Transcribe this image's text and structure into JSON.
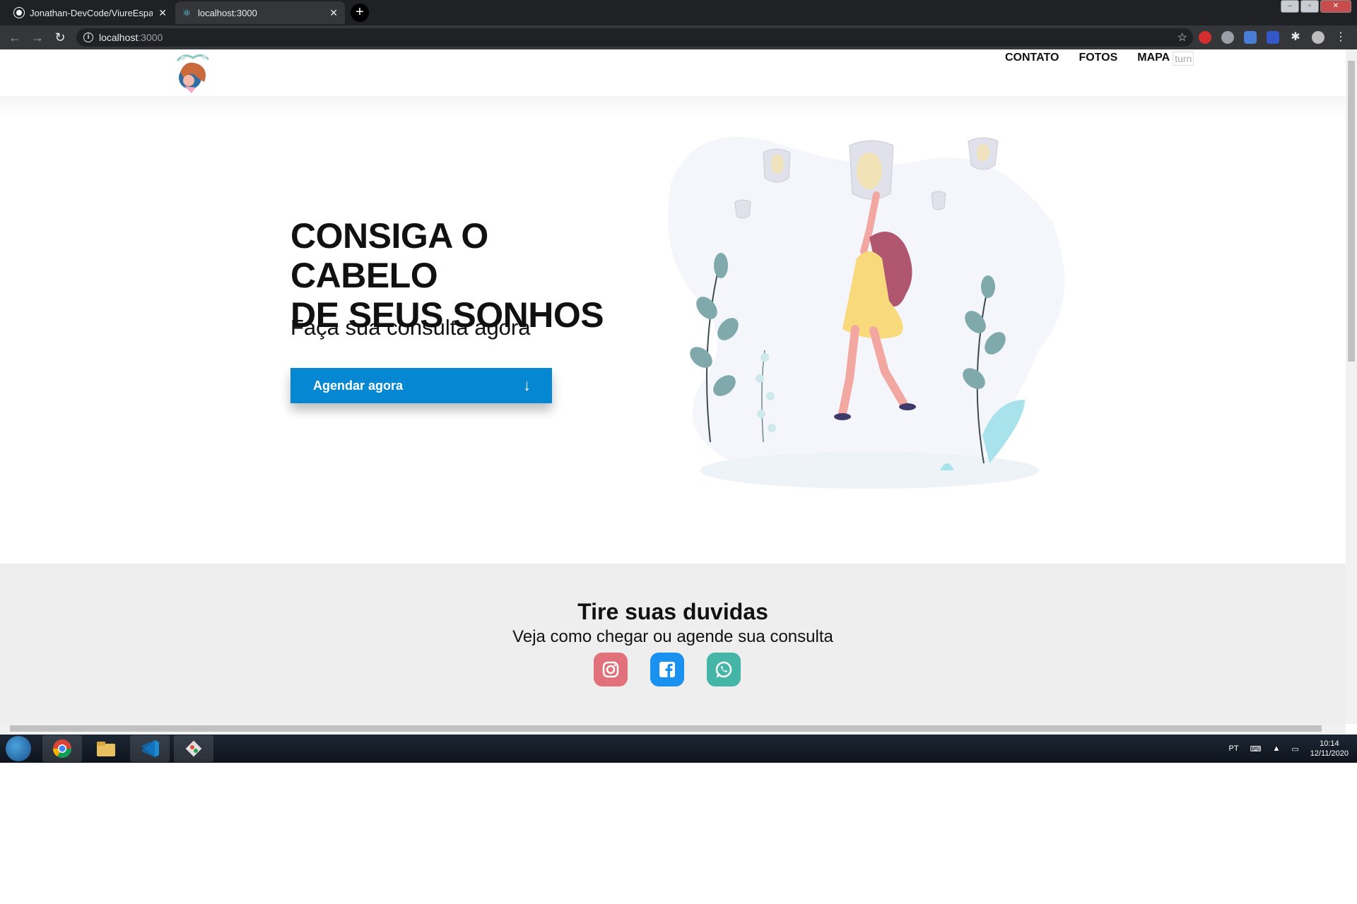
{
  "browser": {
    "tabs": [
      {
        "title": "Jonathan-DevCode/ViureEspai",
        "close": "✕"
      },
      {
        "title": "localhost:3000",
        "close": "✕"
      }
    ],
    "new_tab": "+",
    "address": {
      "host": "localhost",
      "port": ":3000"
    },
    "window_controls": [
      "–",
      "▫",
      "✕"
    ]
  },
  "nav": {
    "items": [
      "CONTATO",
      "FOTOS",
      "MAPA"
    ],
    "overlay_text": "turn"
  },
  "hero": {
    "title_line1": "CONSIGA O CABELO",
    "title_line2": "DE SEUS SONHOS",
    "subtitle": "Faça sua consulta agora",
    "cta_label": "Agendar agora",
    "cta_icon": "arrow-down-icon"
  },
  "contact": {
    "title": "Tire suas duvidas",
    "subtitle": "Veja como chegar ou agende sua consulta",
    "social": [
      {
        "name": "instagram-icon",
        "color": "#e1717a"
      },
      {
        "name": "facebook-icon",
        "color": "#1a91ef"
      },
      {
        "name": "whatsapp-icon",
        "color": "#45b5a8"
      }
    ]
  },
  "taskbar": {
    "lang": "PT",
    "time": "10:14",
    "date": "12/11/2020"
  },
  "colors": {
    "cta": "#0588d1",
    "contact_bg": "#eeeeee",
    "chrome_dark": "#202124"
  }
}
